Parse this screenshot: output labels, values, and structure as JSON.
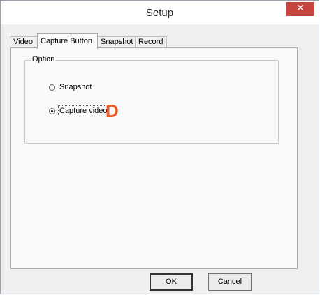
{
  "window": {
    "title": "Setup",
    "close_glyph": "✕"
  },
  "tabs": [
    {
      "label": "Video",
      "active": false
    },
    {
      "label": "Capture Button",
      "active": true
    },
    {
      "label": "Snapshot",
      "active": false
    },
    {
      "label": "Record",
      "active": false
    }
  ],
  "option_group": {
    "label": "Option",
    "options": [
      {
        "label": "Snapshot",
        "selected": false
      },
      {
        "label": "Capture video",
        "selected": true
      }
    ]
  },
  "marker_letter": "D",
  "buttons": {
    "ok": "OK",
    "cancel": "Cancel"
  },
  "colors": {
    "close_button": "#c8453f",
    "marker": "#ee5a24"
  }
}
